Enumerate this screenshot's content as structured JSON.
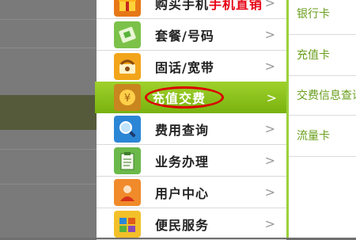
{
  "menu": {
    "items": [
      {
        "label_a": "购买手机",
        "label_b": "手机直销",
        "icon": "gift-icon",
        "color": "#e77817"
      },
      {
        "label": "套餐/号码",
        "icon": "sim-card-icon",
        "color": "#58b33c"
      },
      {
        "label": "固话/宽带",
        "icon": "phone-icon",
        "color": "#f2a51a"
      },
      {
        "label": "充值交费",
        "icon": "coin-icon",
        "color": "#d08a1c",
        "active": true
      },
      {
        "label": "费用查询",
        "icon": "magnifier-icon",
        "color": "#2c86d6"
      },
      {
        "label": "业务办理",
        "icon": "clipboard-icon",
        "color": "#4aa53c"
      },
      {
        "label": "用户中心",
        "icon": "user-icon",
        "color": "#e05a1a"
      },
      {
        "label": "便民服务",
        "icon": "services-icon",
        "color": "#f0b020"
      }
    ],
    "chevron": ">"
  },
  "submenu": {
    "items": [
      "银行卡",
      "充值卡",
      "交费信息查询",
      "流量卡"
    ]
  },
  "colors": {
    "active_green": "#8cc41e",
    "highlight_red": "#d90000",
    "sub_text_green": "#6a9e1c"
  }
}
